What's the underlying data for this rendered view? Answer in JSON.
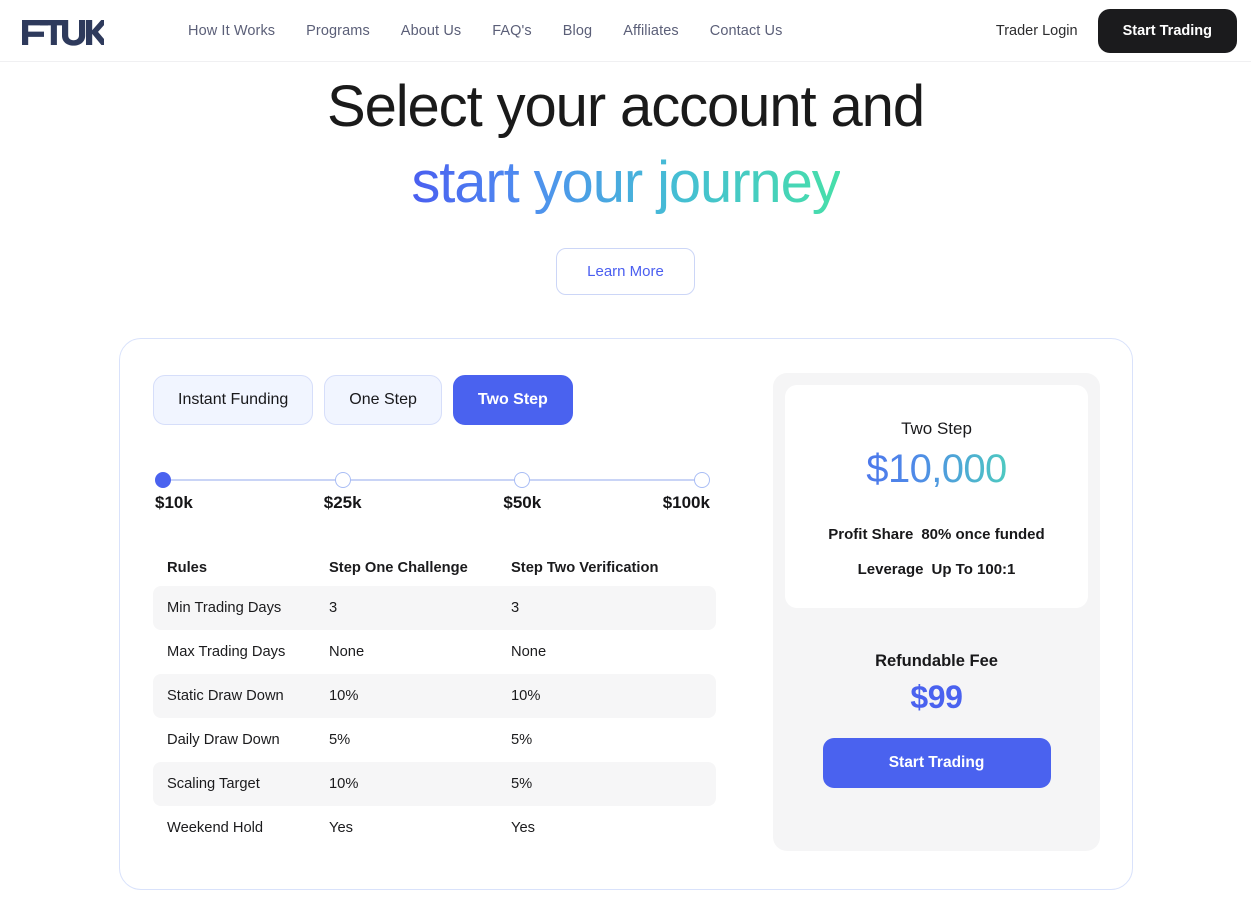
{
  "header": {
    "logo_text": "FTUK",
    "nav": [
      {
        "label": "How It Works"
      },
      {
        "label": "Programs"
      },
      {
        "label": "About Us"
      },
      {
        "label": "FAQ's"
      },
      {
        "label": "Blog"
      },
      {
        "label": "Affiliates"
      },
      {
        "label": "Contact Us"
      }
    ],
    "trader_login": "Trader Login",
    "start_trading": "Start Trading"
  },
  "hero": {
    "line1": "Select your account and",
    "line2": "start your journey",
    "learn_more": "Learn More"
  },
  "tabs": [
    {
      "label": "Instant Funding",
      "active": false
    },
    {
      "label": "One Step",
      "active": false
    },
    {
      "label": "Two Step",
      "active": true
    }
  ],
  "slider": {
    "selected_index": 0,
    "points": [
      {
        "label": "$10k"
      },
      {
        "label": "$25k"
      },
      {
        "label": "$50k"
      },
      {
        "label": "$100k"
      }
    ]
  },
  "rules_table": {
    "headers": [
      "Rules",
      "Step One Challenge",
      "Step Two Verification"
    ],
    "rows": [
      {
        "rule": "Min Trading Days",
        "step_one": "3",
        "step_two": "3"
      },
      {
        "rule": "Max Trading Days",
        "step_one": "None",
        "step_two": "None"
      },
      {
        "rule": "Static Draw Down",
        "step_one": "10%",
        "step_two": "10%"
      },
      {
        "rule": "Daily Draw Down",
        "step_one": "5%",
        "step_two": "5%"
      },
      {
        "rule": "Scaling Target",
        "step_one": "10%",
        "step_two": "5%"
      },
      {
        "rule": "Weekend Hold",
        "step_one": "Yes",
        "step_two": "Yes"
      }
    ]
  },
  "price_card": {
    "plan_title": "Two Step",
    "amount": "$10,000",
    "profit_share_label": "Profit Share",
    "profit_share_value": "80% once funded",
    "leverage_label": "Leverage",
    "leverage_value": "Up To 100:1",
    "fee_label": "Refundable Fee",
    "fee_amount": "$99",
    "cta": "Start Trading"
  },
  "colors": {
    "brand_blue": "#4a62ef",
    "brand_teal": "#47dfa9",
    "logo_navy": "#2e3a5c",
    "dark_button": "#1b1b1d",
    "row_shade": "#f6f6f7"
  }
}
